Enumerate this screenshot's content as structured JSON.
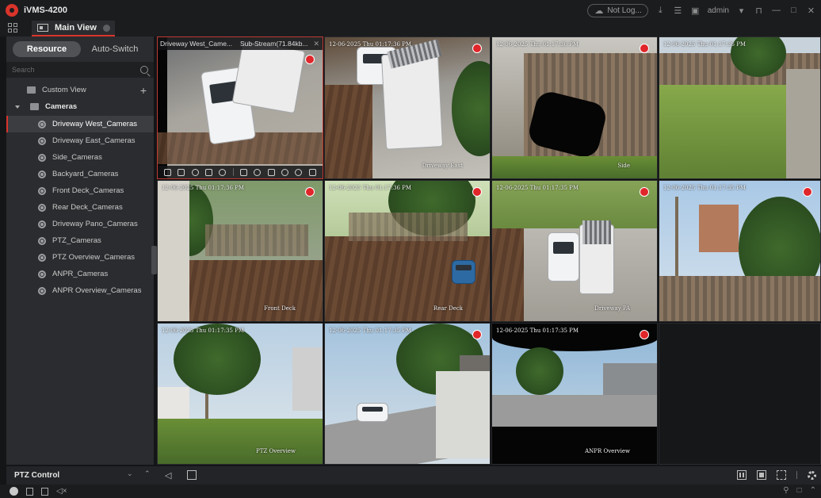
{
  "app": {
    "title": "iVMS-4200"
  },
  "titlebar": {
    "cloud_status": "Not Log...",
    "user": "admin"
  },
  "tabs": [
    {
      "label": "Main View"
    }
  ],
  "resource_panel": {
    "segments": [
      {
        "label": "Resource",
        "active": true
      },
      {
        "label": "Auto-Switch",
        "active": false
      }
    ],
    "search_placeholder": "Search",
    "custom_view": "Custom View",
    "cameras_group": "Cameras",
    "cameras": [
      "Driveway West_Cameras",
      "Driveway East_Cameras",
      "Side_Cameras",
      "Backyard_Cameras",
      "Front Deck_Cameras",
      "Rear Deck_Cameras",
      "Driveway Pano_Cameras",
      "PTZ_Cameras",
      "PTZ Overview_Cameras",
      "ANPR_Cameras",
      "ANPR Overview_Cameras"
    ],
    "selected_camera": "Driveway West_Cameras"
  },
  "video_grid": {
    "selected_tile": {
      "title": "Driveway West_Came...",
      "stream": "Sub-Stream(71.84kb..."
    },
    "tiles": [
      {
        "timestamp": "",
        "name": ""
      },
      {
        "timestamp": "12-06-2025 Thu 01:17:36 PM",
        "name": "Driveway East"
      },
      {
        "timestamp": "12-06-2025 Thu 01:17:36 PM",
        "name": "Side"
      },
      {
        "timestamp": "12-06-2025 Thu 01:17:36 PM",
        "name": ""
      },
      {
        "timestamp": "12-06-2025 Thu 01:17:36 PM",
        "name": "Front Deck"
      },
      {
        "timestamp": "12-06-2025 Thu 01:17:36 PM",
        "name": "Rear Deck"
      },
      {
        "timestamp": "12-06-2025 Thu 01:17:35 PM",
        "name": "Driveway PA"
      },
      {
        "timestamp": "12-06-2025 Thu 01:17:35 PM",
        "name": ""
      },
      {
        "timestamp": "12-06-2025 Thu 01:17:35 PM",
        "name": "PTZ Overview"
      },
      {
        "timestamp": "12-06-2025 Thu 01:17:35 PM",
        "name": ""
      },
      {
        "timestamp": "12-06-2025 Thu 01:17:35 PM",
        "name": "ANPR Overview"
      }
    ]
  },
  "bottom": {
    "ptz_label": "PTZ Control"
  },
  "colors": {
    "accent": "#d9342b",
    "panel": "#2b2c2f",
    "background": "#141517"
  }
}
